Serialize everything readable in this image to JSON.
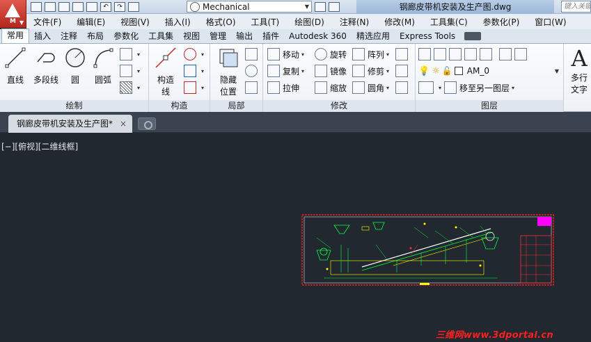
{
  "app": {
    "letter": "M",
    "caret": "▼"
  },
  "workspace": {
    "name": "Mechanical"
  },
  "title": {
    "file": "钢廊皮带机安装及生产图.dwg"
  },
  "search": {
    "placeholder": "键入关键字"
  },
  "menu": [
    "文件(F)",
    "编辑(E)",
    "视图(V)",
    "插入(I)",
    "格式(O)",
    "工具(T)",
    "绘图(D)",
    "注释(N)",
    "修改(M)",
    "工具集(C)",
    "参数化(P)",
    "窗口(W)"
  ],
  "ribbon_tabs": [
    "常用",
    "插入",
    "注释",
    "布局",
    "参数化",
    "工具集",
    "视图",
    "管理",
    "输出",
    "插件",
    "Autodesk 360",
    "精选应用",
    "Express Tools"
  ],
  "panels": {
    "draw": {
      "title": "绘制",
      "line": "直线",
      "polyline": "多段线",
      "circle": "圆",
      "arc": "圆弧"
    },
    "construct": {
      "title": "构造",
      "xline_a": "构造",
      "xline_b": "线"
    },
    "local": {
      "title": "局部",
      "hide_a": "隐藏",
      "hide_b": "位置"
    },
    "modify": {
      "title": "修改",
      "move": "移动",
      "rotate": "旋转",
      "array": "阵列",
      "copy": "复制",
      "mirror": "镜像",
      "trim": "修剪",
      "stretch": "拉伸",
      "scale": "缩放",
      "fillet": "圆角"
    },
    "layers": {
      "title": "图层",
      "current_layer": "AM_0",
      "move_to_layer": "移至另一图层"
    },
    "text": {
      "letter": "A",
      "label_a": "多行",
      "label_b": "文字"
    }
  },
  "doc_tab": {
    "label": "钢廊皮带机安装及生产图*",
    "close": "×"
  },
  "viewport": {
    "label": "[−][俯视][二维线框]"
  },
  "watermark": {
    "text": "三维网www.3dportal.cn"
  },
  "colors": {
    "canvas": "#212830",
    "drawing_green": "#00ff40",
    "drawing_yellow": "#ffff00",
    "border_red": "#ff2020",
    "magenta": "#ff00ff"
  }
}
